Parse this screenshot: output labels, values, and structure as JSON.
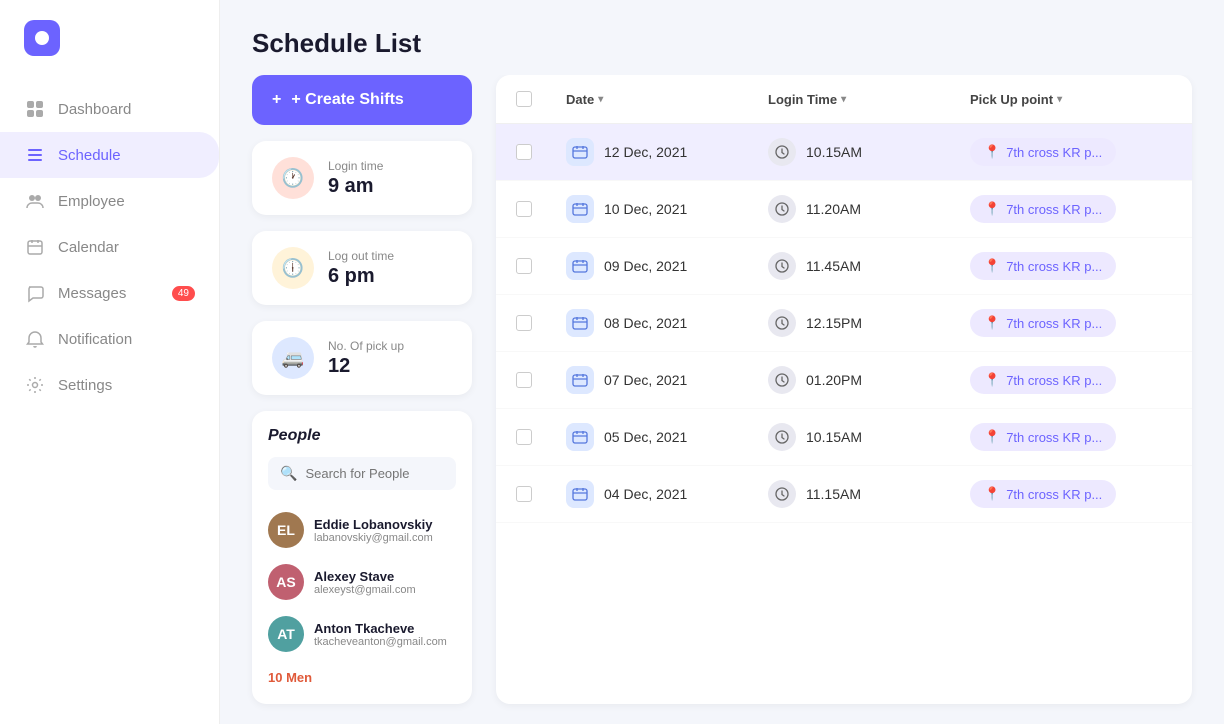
{
  "sidebar": {
    "items": [
      {
        "label": "Dashboard",
        "icon": "⊞",
        "active": false,
        "badge": null
      },
      {
        "label": "Schedule",
        "icon": "☰",
        "active": true,
        "badge": null
      },
      {
        "label": "Employee",
        "icon": "👥",
        "active": false,
        "badge": null
      },
      {
        "label": "Calendar",
        "icon": "📅",
        "active": false,
        "badge": null
      },
      {
        "label": "Messages",
        "icon": "📊",
        "active": false,
        "badge": "49"
      },
      {
        "label": "Notification",
        "icon": "🔔",
        "active": false,
        "badge": null
      },
      {
        "label": "Settings",
        "icon": "⚙",
        "active": false,
        "badge": null
      }
    ]
  },
  "header": {
    "title": "Schedule List"
  },
  "left_panel": {
    "create_btn": "+ Create Shifts",
    "login_time": {
      "label": "Login time",
      "value": "9 am"
    },
    "logout_time": {
      "label": "Log out time",
      "value": "6 pm"
    },
    "pickup": {
      "label": "No. Of pick up",
      "value": "12"
    },
    "people": {
      "title": "People",
      "search_placeholder": "Search for People",
      "persons": [
        {
          "name": "Eddie Lobanovskiy",
          "email": "labanovskiy@gmail.com",
          "color": "#a07850"
        },
        {
          "name": "Alexey Stave",
          "email": "alexeyst@gmail.com",
          "color": "#c06070"
        },
        {
          "name": "Anton Tkacheve",
          "email": "tkacheveanton@gmail.com",
          "color": "#50a0a0"
        }
      ],
      "count": "10 Men"
    }
  },
  "table": {
    "columns": [
      "",
      "Date",
      "Login Time",
      "Pick Up point"
    ],
    "rows": [
      {
        "date": "12 Dec, 2021",
        "login_time": "10.15AM",
        "pickup": "7th cross KR p...",
        "highlighted": true
      },
      {
        "date": "10 Dec, 2021",
        "login_time": "11.20AM",
        "pickup": "7th cross KR p...",
        "highlighted": false
      },
      {
        "date": "09 Dec, 2021",
        "login_time": "11.45AM",
        "pickup": "7th cross KR p...",
        "highlighted": false
      },
      {
        "date": "08 Dec, 2021",
        "login_time": "12.15PM",
        "pickup": "7th cross KR p...",
        "highlighted": false
      },
      {
        "date": "07 Dec, 2021",
        "login_time": "01.20PM",
        "pickup": "7th cross KR p...",
        "highlighted": false
      },
      {
        "date": "05 Dec, 2021",
        "login_time": "10.15AM",
        "pickup": "7th cross KR p...",
        "highlighted": false
      },
      {
        "date": "04 Dec, 2021",
        "login_time": "11.15AM",
        "pickup": "7th cross KR p...",
        "highlighted": false
      }
    ]
  }
}
